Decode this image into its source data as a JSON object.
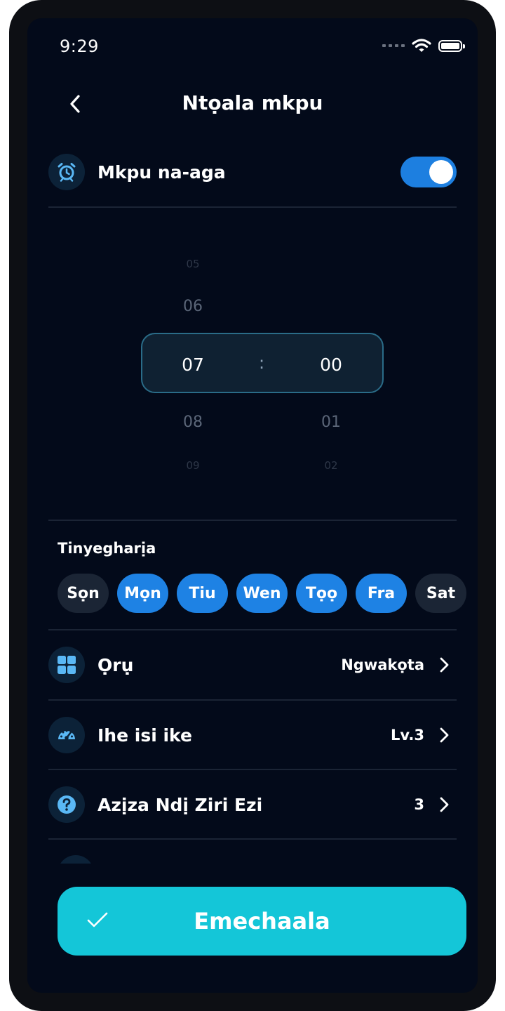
{
  "status_bar": {
    "time": "9:29"
  },
  "header": {
    "title": "Ntọala mkpu"
  },
  "alarm": {
    "label": "Mkpu na-aga",
    "enabled": true
  },
  "time_picker": {
    "hours": [
      "05",
      "06",
      "07",
      "08",
      "09"
    ],
    "minutes": [
      "00",
      "01",
      "02"
    ],
    "selected_hour": "07",
    "selected_minute": "00",
    "separator": ":"
  },
  "repeat": {
    "label": "Tinyegharịa",
    "days": [
      {
        "label": "Sọn",
        "selected": false
      },
      {
        "label": "Mọn",
        "selected": true
      },
      {
        "label": "Tiu",
        "selected": true
      },
      {
        "label": "Wen",
        "selected": true
      },
      {
        "label": "Tọọ",
        "selected": true
      },
      {
        "label": "Fra",
        "selected": true
      },
      {
        "label": "Sat",
        "selected": false
      }
    ]
  },
  "settings": [
    {
      "label": "Ọrụ",
      "value": "Ngwakọta",
      "icon": "grid-icon"
    },
    {
      "label": "Ihe isi ike",
      "value": "Lv.3",
      "icon": "gauge-icon"
    },
    {
      "label": "Azịza Ndị Ziri Ezi",
      "value": "3",
      "icon": "question-icon"
    }
  ],
  "confirm": {
    "label": "Emechaala"
  },
  "colors": {
    "background": "#030a1a",
    "accent_blue": "#1e82e4",
    "toggle_on": "#1d7fe0",
    "confirm_cyan": "#14c6d8",
    "icon_blue": "#5ab8f5"
  }
}
